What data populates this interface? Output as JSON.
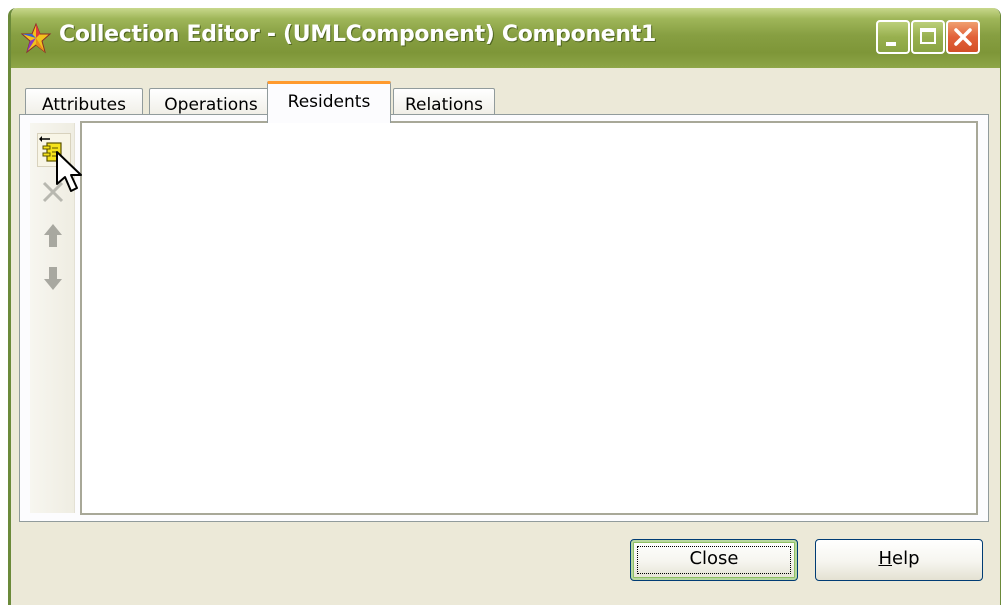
{
  "window": {
    "title": "Collection Editor - (UMLComponent) Component1"
  },
  "tabs": [
    {
      "label": "Attributes",
      "active": false
    },
    {
      "label": "Operations",
      "active": false
    },
    {
      "label": "Residents",
      "active": true
    },
    {
      "label": "Relations",
      "active": false
    }
  ],
  "toolbar": {
    "items": [
      {
        "icon": "add-resident-icon",
        "enabled": true
      },
      {
        "icon": "delete-icon",
        "enabled": false
      },
      {
        "icon": "move-up-icon",
        "enabled": false
      },
      {
        "icon": "move-down-icon",
        "enabled": false
      }
    ]
  },
  "residents_list": {
    "items": []
  },
  "buttons": {
    "close_label": "Close",
    "help_mnemonic": "H",
    "help_rest": "elp"
  },
  "colors": {
    "titlebar": "#879f42",
    "active_tab_accent": "#ff9a2e",
    "window_bg": "#ece9d8",
    "close_button": "#e2613a"
  }
}
